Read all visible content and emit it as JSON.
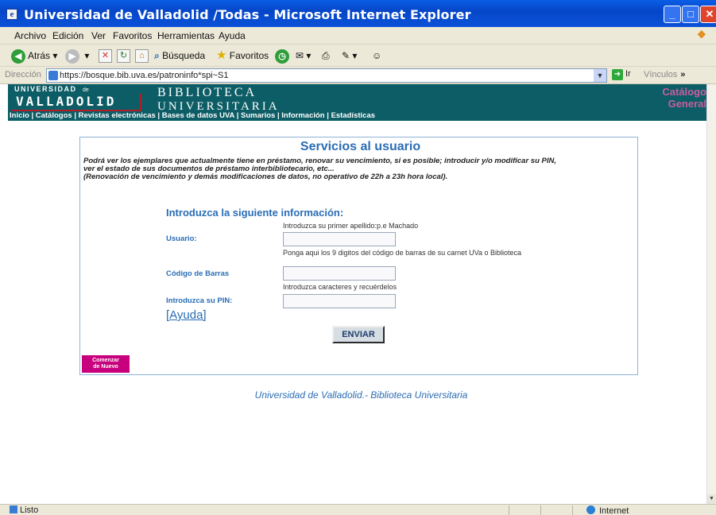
{
  "window": {
    "title": "Universidad de Valladolid /Todas - Microsoft Internet Explorer"
  },
  "menu": [
    "Archivo",
    "Edición",
    "Ver",
    "Favoritos",
    "Herramientas",
    "Ayuda"
  ],
  "toolbar": {
    "back": "Atrás",
    "search": "Búsqueda",
    "favorites": "Favoritos"
  },
  "address": {
    "label": "Dirección",
    "url": "https://bosque.bib.uva.es/patroninfo*spi~S1",
    "go": "Ir",
    "links": "Vínculos"
  },
  "banner": {
    "university_small": "UNIVERSIDAD",
    "university_de": "de",
    "university_big": "VALLADOLID",
    "library_line1": "BIBLIOTECA",
    "library_line2": "UNIVERSITARIA",
    "catalog_line1": "Catálogo",
    "catalog_line2": "General",
    "nav": [
      "Inicio",
      "Catálogos",
      "Revistas electrónicas",
      "Bases de datos UVA",
      "Sumarios",
      "Información",
      "Estadísticas"
    ],
    "nav_sep": " | "
  },
  "page": {
    "heading": "Servicios al usuario",
    "intro_line1": "Podrá ver los ejemplares que actualmente tiene en préstamo, renovar su vencimiento, si es posible; introducir y/o modificar su PIN,",
    "intro_line2": "ver el estado de sus documentos de préstamo interbibliotecario, etc...",
    "intro_line3": "(Renovación de vencimiento y demás modificaciones de datos, no operativo de 22h a 23h hora local).",
    "form_title": "Introduzca la siguiente información:",
    "user_hint": "Introduzca su primer apellido:p.e Machado",
    "user_label": "Usuario:",
    "barcode_hint": "Ponga aqui los 9 digitos del código de barras de su carnet UVa o Biblioteca",
    "barcode_label": "Código de Barras",
    "pin_hint": "Introduzca caracteres y recuérdelos",
    "pin_label": "Introduzca su PIN:",
    "help": "[Ayuda]",
    "submit": "ENVIAR",
    "restart_line1": "Comenzar",
    "restart_line2": "de Nuevo",
    "footer": "Universidad de Valladolid.- Biblioteca Universitaria"
  },
  "status": {
    "text": "Listo",
    "zone": "Internet"
  },
  "colors": {
    "banner": "#0d5d66",
    "accent_blue": "#2a6db5",
    "restart": "#c8007e",
    "titlebar": "#0646c8"
  }
}
